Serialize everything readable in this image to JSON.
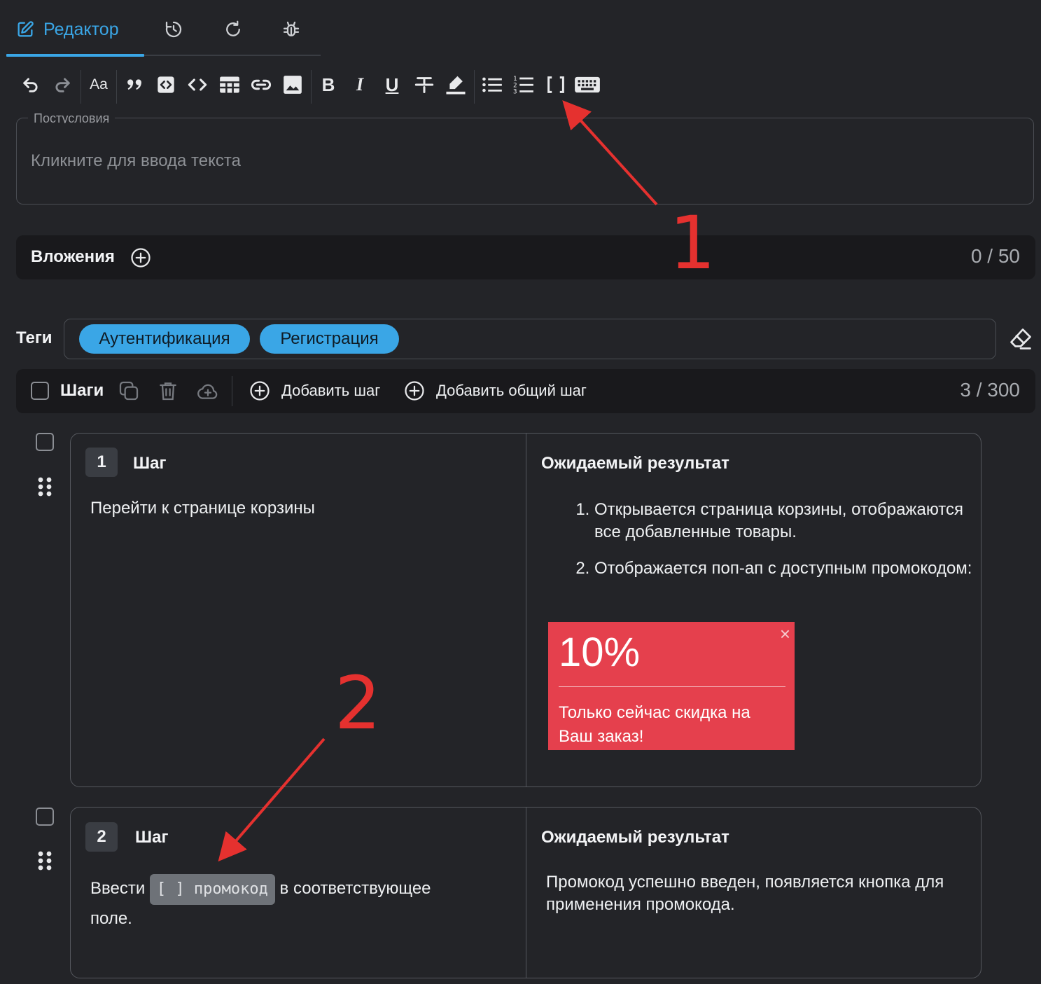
{
  "tabs": {
    "editor_label": "Редактор"
  },
  "toolbar": {
    "font_size_label": "Aa",
    "bold_label": "B",
    "italic_label": "I",
    "underline_label": "U"
  },
  "postconditions": {
    "legend": "Постусловия",
    "placeholder": "Кликните для ввода текста"
  },
  "attachments": {
    "label": "Вложения",
    "count": "0 / 50"
  },
  "tags": {
    "label": "Теги",
    "items": [
      "Аутентификация",
      "Регистрация"
    ]
  },
  "steps_bar": {
    "label": "Шаги",
    "add_step": "Добавить шаг",
    "add_shared_step": "Добавить общий шаг",
    "count": "3 / 300"
  },
  "steps": [
    {
      "number": "1",
      "step_header": "Шаг",
      "expected_header": "Ожидаемый результат",
      "action": "Перейти к странице корзины",
      "expected_items": [
        "Открывается страница корзины, отображаются все добавленные товары.",
        "Отображается поп-ап с доступным промокодом:"
      ],
      "promo": {
        "percent": "10%",
        "text": "Только сейчас скидка на Ваш заказ!",
        "close": "×"
      }
    },
    {
      "number": "2",
      "step_header": "Шаг",
      "expected_header": "Ожидаемый результат",
      "action_before": "Ввести",
      "action_code": "[ ] промокод",
      "action_after": "в соответствующее",
      "action_line2": "поле.",
      "expected_text": "Промокод успешно введен, появляется кнопка для применения промокода."
    }
  ],
  "annotations": {
    "first": "1",
    "second": "2",
    "color": "#e5312f"
  },
  "colors": {
    "accent": "#3aa6e6",
    "background": "#232428",
    "bar": "#19191c",
    "promo": "#e5404d"
  }
}
